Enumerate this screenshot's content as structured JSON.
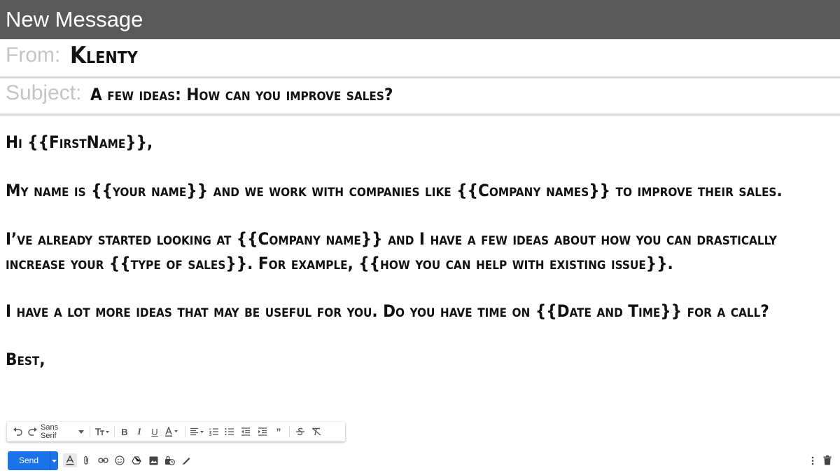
{
  "window": {
    "title": "New Message"
  },
  "from": {
    "label": "From:",
    "value": "Klenty"
  },
  "subject": {
    "label": "Subject:",
    "value": "A few ideas: How can you improve sales?"
  },
  "body": {
    "lines": [
      "Hi {{FirstName}},",
      "My name is {{your name}} and we work with companies like {{Company names}} to improve their sales.",
      "I’ve already started looking at {{Company name}} and I have a few ideas about how you can drastically",
      "increase your {{type of sales}}. For example, {{how you can help with existing issue}}.",
      "I have a lot more ideas that may be useful for you. Do you have time on {{Date and Time}} for a call?",
      "Best,"
    ]
  },
  "formatting_toolbar": {
    "font_name": "Sans Serif",
    "icons": [
      "undo-icon",
      "redo-icon",
      "font-dropdown",
      "text-size-icon",
      "bold-icon",
      "italic-icon",
      "underline-icon",
      "text-color-icon",
      "align-icon",
      "numbered-list-icon",
      "bulleted-list-icon",
      "indent-less-icon",
      "indent-more-icon",
      "quote-icon",
      "strikethrough-icon",
      "remove-formatting-icon"
    ]
  },
  "bottom_toolbar": {
    "send_label": "Send",
    "accent_color": "#1a73e8",
    "icons": [
      "formatting-options-icon",
      "attach-icon",
      "link-icon",
      "emoji-icon",
      "drive-icon",
      "photo-icon",
      "confidential-icon",
      "signature-icon",
      "more-options-icon",
      "trash-icon"
    ]
  },
  "colors": {
    "titlebar": "#595959",
    "label": "#c4c4c4",
    "divider": "#d9d9d9"
  }
}
